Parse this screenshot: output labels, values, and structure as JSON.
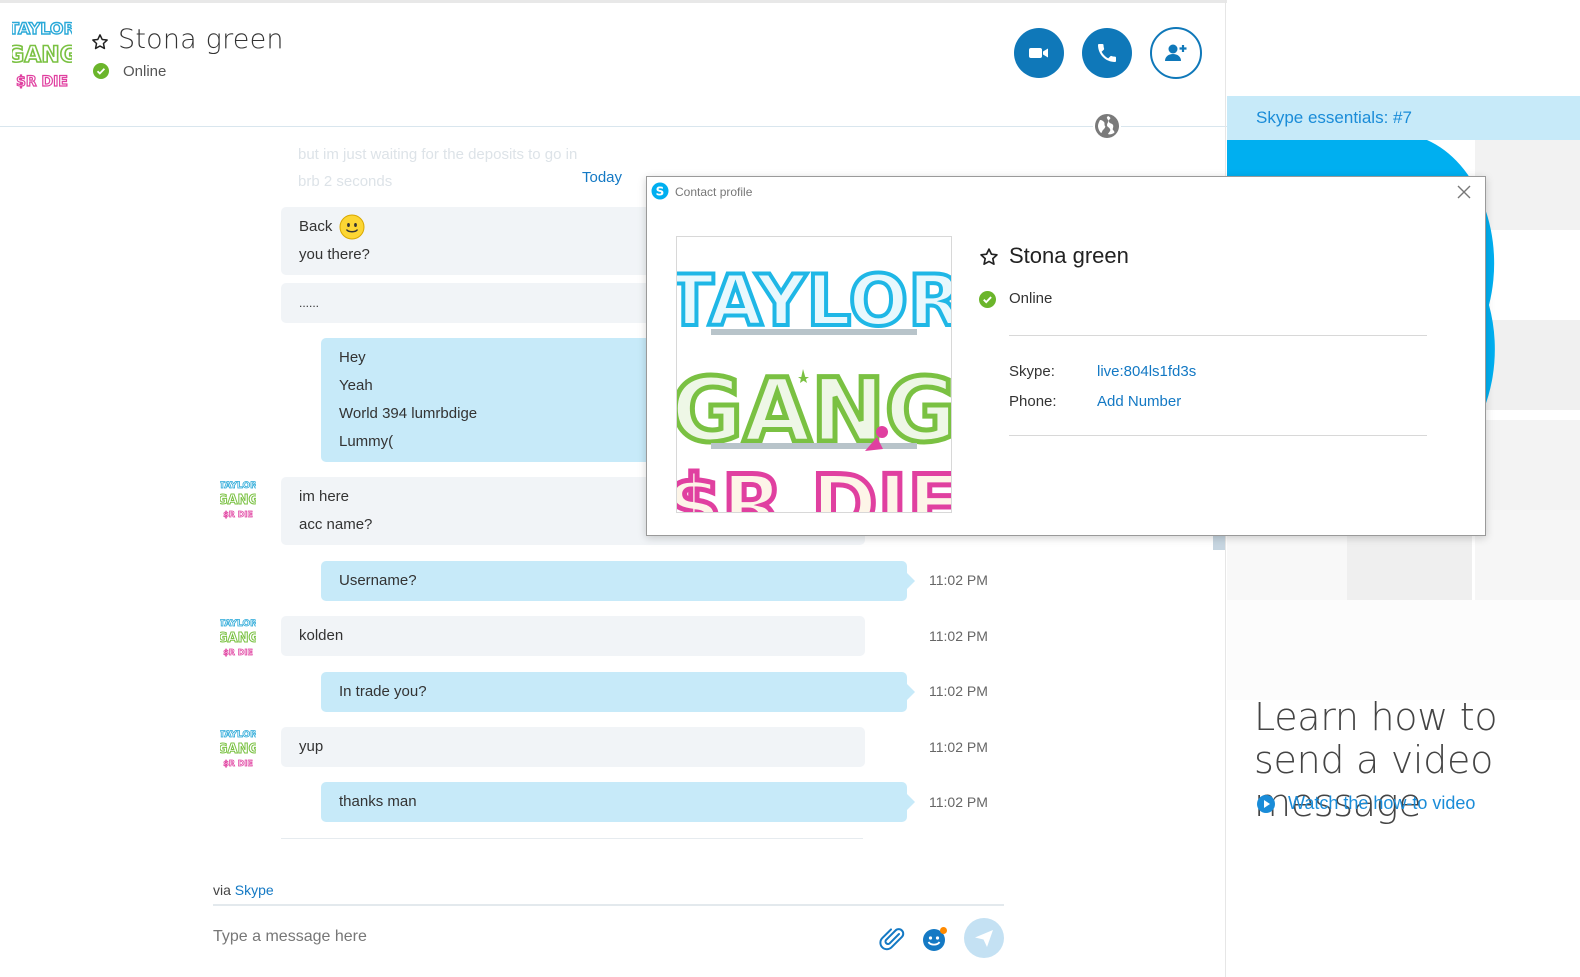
{
  "header": {
    "contact_name": "Stona green",
    "status": "Online"
  },
  "conversation": {
    "faded_lines": [
      "but im just waiting for the deposits to go in",
      "brb 2 seconds"
    ],
    "date_divider": "Today",
    "messages": [
      {
        "direction": "in",
        "lines": [
          "Back",
          "you there?"
        ],
        "has_emoticon": true,
        "time": ""
      },
      {
        "direction": "in",
        "lines": [
          "......"
        ],
        "time": ""
      },
      {
        "direction": "out",
        "lines": [
          "Hey",
          "Yeah",
          "World 394 lumrbdige",
          "Lummy("
        ],
        "time": ""
      },
      {
        "direction": "in",
        "lines": [
          "im here",
          "acc name?"
        ],
        "time": ""
      },
      {
        "direction": "out",
        "lines": [
          "Username?"
        ],
        "time": "11:02 PM"
      },
      {
        "direction": "in",
        "lines": [
          "kolden"
        ],
        "time": "11:02 PM"
      },
      {
        "direction": "out",
        "lines": [
          "In trade you?"
        ],
        "time": "11:02 PM"
      },
      {
        "direction": "in",
        "lines": [
          "yup"
        ],
        "time": "11:02 PM"
      },
      {
        "direction": "out",
        "lines": [
          "thanks man"
        ],
        "time": "11:02 PM"
      }
    ]
  },
  "composer": {
    "via_prefix": "via",
    "via_link": "Skype",
    "placeholder": "Type a message here"
  },
  "right_pane": {
    "essentials": "Skype essentials: #7",
    "learn_title": "Learn how to send a video message",
    "watch_link": "Watch the how-to video"
  },
  "profile_dialog": {
    "title": "Contact profile",
    "name": "Stona green",
    "status": "Online",
    "skype_label": "Skype:",
    "skype_value": "live:804ls1fd3s",
    "phone_label": "Phone:",
    "phone_value": "Add Number"
  },
  "logo_text": {
    "line1": "TAYLOR",
    "line2": "GANG",
    "line3": "$R DIE"
  },
  "colors": {
    "accent": "#0f78b9",
    "link": "#1479c4",
    "outgoing_bubble": "#c7eaf9",
    "incoming_bubble": "#f1f4f7",
    "online": "#6bb52b",
    "skype_blue": "#00aff0"
  }
}
